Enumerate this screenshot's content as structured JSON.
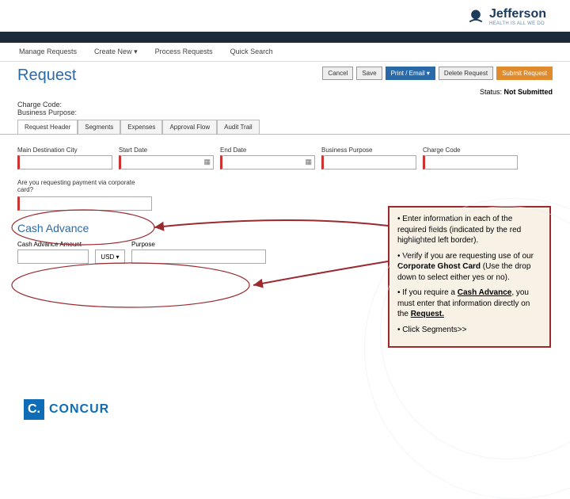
{
  "brand": {
    "name": "Jefferson",
    "tagline": "HEALTH IS ALL WE DO"
  },
  "subnav": {
    "manage": "Manage Requests",
    "create": "Create New ▾",
    "process": "Process Requests",
    "quick": "Quick Search"
  },
  "page_title": "Request",
  "buttons": {
    "cancel": "Cancel",
    "save": "Save",
    "print": "Print / Email ▾",
    "delete": "Delete Request",
    "submit": "Submit Request"
  },
  "status": {
    "label": "Status:",
    "value": "Not Submitted"
  },
  "info": {
    "charge": "Charge Code:",
    "bp": "Business Purpose:"
  },
  "tabs": {
    "header": "Request Header",
    "segments": "Segments",
    "expenses": "Expenses",
    "flow": "Approval Flow",
    "audit": "Audit Trail"
  },
  "fields": {
    "dest": "Main Destination City",
    "start": "Start Date",
    "end": "End Date",
    "bp": "Business Purpose",
    "cc": "Charge Code",
    "corp": "Are you requesting payment via corporate card?"
  },
  "cash_advance": {
    "title": "Cash Advance",
    "amount": "Cash Advance Amount",
    "currency": "USD ▾",
    "purpose": "Purpose"
  },
  "callout": {
    "p1": "• Enter information in each of the required fields (indicated by the red highlighted left border).",
    "p2_a": "• Verify if you are requesting use of our ",
    "p2_b": "Corporate Ghost Card",
    "p2_c": " (Use the drop down to select either yes or no).",
    "p3_a": "• If you require a ",
    "p3_b": "Cash Advance",
    "p3_c": ", you must enter that information directly on the ",
    "p3_d": "Request.",
    "p4": "• Click Segments>>"
  },
  "concur": {
    "c": "C.",
    "name": "CONCUR"
  }
}
